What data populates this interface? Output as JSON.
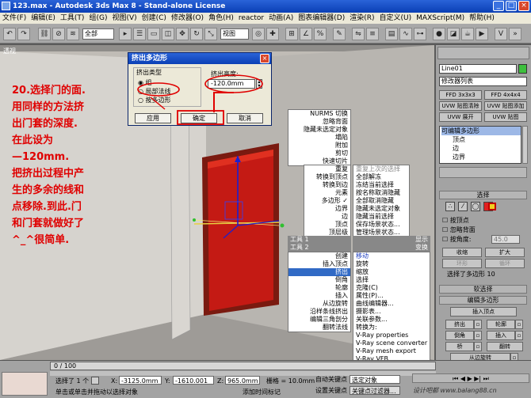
{
  "titlebar": {
    "title": "123.max - Autodesk 3ds Max 8 - Stand-alone License"
  },
  "menubar": {
    "items": [
      "文件(F)",
      "编辑(E)",
      "工具(T)",
      "组(G)",
      "视图(V)",
      "创建(C)",
      "修改器(O)",
      "角色(H)",
      "reactor",
      "动画(A)",
      "图表编辑器(D)",
      "渲染(R)",
      "自定义(U)",
      "MAXScript(M)",
      "帮助(H)"
    ]
  },
  "toolbar": {
    "filter": "全部",
    "view": "视图"
  },
  "viewport": {
    "label": "透视"
  },
  "dialog": {
    "title": "挤出多边形",
    "type_label": "挤出类型",
    "opt_group": "组",
    "opt_local": "局部法线",
    "opt_polygon": "按多边形",
    "height_label": "挤出高度:",
    "height_value": "-120.0mm",
    "apply": "应用",
    "ok": "确定",
    "cancel": "取消"
  },
  "annotation": {
    "lines": [
      "20.选择门的面.",
      "用同样的方法挤",
      "出门套的深度.",
      "在此设为",
      "—120mm.",
      "把挤出过程中产",
      "生的多余的线和",
      "点移除.到此.门",
      "和门套就做好了",
      "^_^很简单."
    ]
  },
  "quad_menu": {
    "tl": [
      "NURMS 切换",
      "忽略背面",
      "隐藏未选定对象",
      "塌陷",
      "附加",
      "剪切",
      "快速切片"
    ],
    "tr": [
      "重复",
      "转换到顶点",
      "转换到边",
      "元素",
      "多边形 ✓",
      "边界",
      "边",
      "顶点",
      "顶层级"
    ],
    "tr2": [
      "重复上次的选择",
      "全部解冻",
      "冻结当前选择",
      "按名称取消隐藏",
      "全部取消隐藏",
      "隐藏未选定对象",
      "隐藏当前选择",
      "保存场景状态...",
      "管理场景状态..."
    ],
    "header_tools1": "工具 1",
    "header_display": "显示",
    "header_tools2": "工具 2",
    "header_transform": "变换",
    "bl": [
      "创建",
      "插入顶点",
      "挤出",
      "倒角",
      "轮廓",
      "插入",
      "从边旋转",
      "沿样条线挤出",
      "编辑三角剖分",
      "翻转法线"
    ],
    "br": [
      "移动",
      "旋转",
      "缩放",
      "选择",
      "克隆(C)",
      "属性(P)...",
      "曲线编辑器...",
      "摄影表...",
      "关联参数...",
      "转换为:",
      "V-Ray properties",
      "V-Ray scene converter",
      "V-Ray mesh export",
      "V-Ray VFB"
    ]
  },
  "cmd": {
    "object_name": "Line01",
    "modifier_list": "修改器列表",
    "btns": [
      "FFD 3x3x3",
      "FFD 4x4x4",
      "UVW 贴图清除",
      "UVW 贴图添加",
      "UVW 展开",
      "UVW 贴图"
    ],
    "stack": [
      "可编辑多边形",
      "顶点",
      "边",
      "边界"
    ],
    "roll_select": "选择",
    "by_vertex": "按顶点",
    "ignore_back": "忽略背面",
    "by_angle": "按角度:",
    "angle_value": "45.0",
    "shrink": "收缩",
    "grow": "扩大",
    "ring": "环形",
    "loop": "循环",
    "selected_info": "选择了多边形 10",
    "roll_soft": "软选择",
    "roll_edit": "编辑多边形",
    "insert_vertex": "插入顶点",
    "extrude": "挤出",
    "outline": "轮廓",
    "bevel": "倒角",
    "inset": "插入",
    "bridge": "桥",
    "flip": "翻转",
    "hinge": "从边旋转"
  },
  "bottom": {
    "frame": "0 / 100",
    "selected": "选择了 1 个",
    "x_label": "X:",
    "x": "-3125.0mm",
    "y_label": "Y:",
    "y": "-1610.001",
    "z_label": "Z:",
    "z": "965.0mm",
    "grid": "栅格 = 10.0mm",
    "autokey": "自动关键点",
    "setkey": "设置关键点",
    "keymode": "选定对象",
    "keyfilter": "关键点过滤器...",
    "prompt": "单击或单击并拖动以选择对象",
    "add_time_tag": "添加时间标记"
  },
  "watermark": "设计吧都 www.balang88.cn"
}
